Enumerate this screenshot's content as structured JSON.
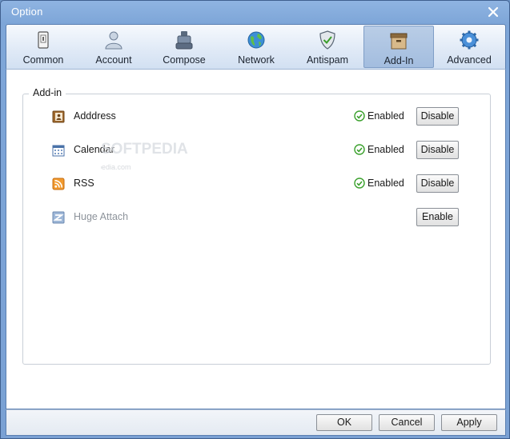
{
  "window": {
    "title": "Option"
  },
  "tabs": [
    {
      "label": "Common",
      "icon": "common-icon"
    },
    {
      "label": "Account",
      "icon": "account-icon"
    },
    {
      "label": "Compose",
      "icon": "compose-icon"
    },
    {
      "label": "Network",
      "icon": "network-icon"
    },
    {
      "label": "Antispam",
      "icon": "antispam-icon"
    },
    {
      "label": "Add-In",
      "icon": "add-in-icon",
      "active": true
    },
    {
      "label": "Advanced",
      "icon": "advanced-icon"
    }
  ],
  "addins": {
    "group_title": "Add-in",
    "items": [
      {
        "name": "Adddress",
        "status": "Enabled",
        "button": "Disable",
        "icon": "address-book-icon"
      },
      {
        "name": "Calendar",
        "status": "Enabled",
        "button": "Disable",
        "icon": "calendar-icon"
      },
      {
        "name": "RSS",
        "status": "Enabled",
        "button": "Disable",
        "icon": "rss-icon"
      },
      {
        "name": "Huge Attach",
        "status": "",
        "button": "Enable",
        "icon": "huge-attach-icon",
        "disabled": true
      }
    ]
  },
  "watermark": {
    "brand": "SOFTPEDIA",
    "url": "www.softpedia.com"
  },
  "footer": {
    "ok": "OK",
    "cancel": "Cancel",
    "apply": "Apply"
  },
  "colors": {
    "title_bar": "#8fb4e2",
    "active_tab": "#a3bddf",
    "enabled_check": "#3aa02c"
  }
}
